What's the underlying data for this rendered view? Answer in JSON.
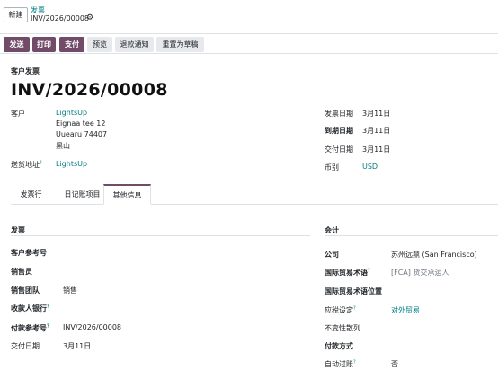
{
  "control_panel": {
    "new_button": "新建",
    "breadcrumb_parent": "发票",
    "breadcrumb_current": "INV/2026/00008"
  },
  "actions": {
    "send": "发送",
    "print": "打印",
    "pay": "支付",
    "preview": "预览",
    "credit_note": "退款通知",
    "reset_draft": "重置为草稿"
  },
  "document": {
    "type_label": "客户发票",
    "name": "INV/2026/00008"
  },
  "header_left": {
    "customer_label": "客户",
    "customer_name": "LightsUp",
    "address_line1": "Eignaa tee 12",
    "address_line2": "Uuearu 74407",
    "address_line3": "黑山",
    "delivery_label": "送货地址",
    "delivery_value": "LightsUp"
  },
  "header_right": {
    "invoice_date_label": "发票日期",
    "invoice_date_value": "3月11日",
    "due_date_label": "到期日期",
    "due_date_value": "3月11日",
    "delivery_date_label": "交付日期",
    "delivery_date_value": "3月11日",
    "currency_label": "币别",
    "currency_value": "USD"
  },
  "tabs": {
    "invoice_lines": "发票行",
    "journal_items": "日记账项目",
    "other_info": "其他信息"
  },
  "other_info": {
    "invoice_section": "发票",
    "customer_reference_label": "客户参考号",
    "salesperson_label": "销售员",
    "sales_team_label": "销售团队",
    "sales_team_value": "销售",
    "recipient_bank_label": "收款人银行",
    "payment_reference_label": "付款参考号",
    "payment_reference_value": "INV/2026/00008",
    "delivery_date_label": "交付日期",
    "delivery_date_value": "3月11日",
    "accounting_section": "会计",
    "company_label": "公司",
    "company_value": "苏州远鼎 (San Francisco)",
    "incoterm_label": "国际贸易术语",
    "incoterm_value": "[FCA] 货交承运人",
    "incoterm_location_label": "国际贸易术语位置",
    "fiscal_position_label": "应税设定",
    "fiscal_position_value": "对外贸易",
    "immutable_hash_label": "不变性散列",
    "payment_method_label": "付款方式",
    "auto_post_label": "自动过账",
    "auto_post_value": "否"
  },
  "colors": {
    "primary": "#714b67",
    "link": "#017e84"
  }
}
